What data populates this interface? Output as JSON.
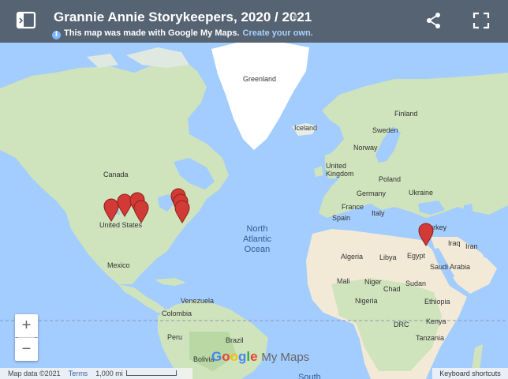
{
  "header": {
    "title": "Grannie Annie Storykeepers, 2020 / 2021",
    "made_with": "This map was made with Google My Maps.",
    "create_link": "Create your own.",
    "star_icon": "star-icon",
    "legend_icon": "legend-toggle-icon",
    "share_icon": "share-icon",
    "fullscreen_icon": "fullscreen-icon"
  },
  "map": {
    "continent_labels": {
      "greenland": "Greenland",
      "iceland": "Iceland",
      "canada": "Canada",
      "finland": "Finland",
      "sweden": "Sweden",
      "norway": "Norway",
      "united_kingdom": "United Kingdom",
      "poland": "Poland",
      "germany": "Germany",
      "ukraine": "Ukraine",
      "france": "France",
      "italy": "Italy",
      "spain": "Spain",
      "turkey": "Turkey",
      "iraq": "Iraq",
      "iran": "Iran",
      "egypt": "Egypt",
      "saudi_arabia": "Saudi Arabia",
      "algeria": "Algeria",
      "libya": "Libya",
      "mali": "Mali",
      "niger": "Niger",
      "chad": "Chad",
      "sudan": "Sudan",
      "ethiopia": "Ethiopia",
      "nigeria": "Nigeria",
      "drc": "DRC",
      "tanzania": "Tanzania",
      "united_states": "United States",
      "mexico": "Mexico",
      "venezuela": "Venezuela",
      "colombia": "Colombia",
      "peru": "Peru",
      "bolivia": "Bolivia",
      "brazil": "Brazil",
      "kenya": "Kenya",
      "north_atlantic": "North Atlantic Ocean",
      "south": "South"
    },
    "marker_count": 8,
    "marker_color": "#d23b35",
    "zoom_in": "+",
    "zoom_out": "−",
    "google_logo": "Google",
    "my_maps": "My Maps",
    "attribution": "Map data ©2021",
    "terms": "Terms",
    "scale": "1,000 mi",
    "keyboard_shortcuts": "Keyboard shortcuts"
  },
  "colors": {
    "header": "#556372",
    "water": "#a3ccff",
    "land": "#cfe3bc",
    "ice": "#ffffff",
    "desert": "#f2ead6",
    "link": "#a9d2ff"
  }
}
